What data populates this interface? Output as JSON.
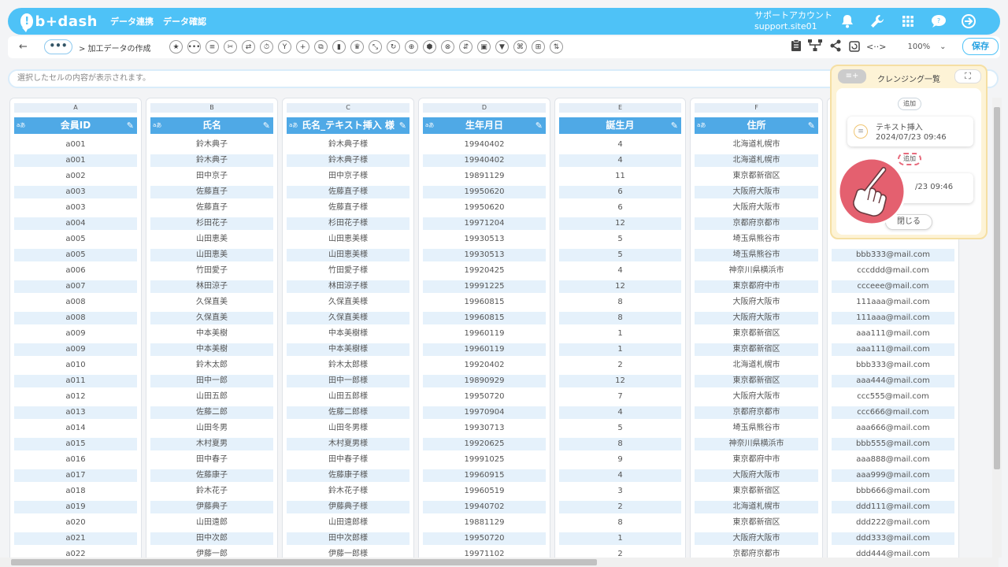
{
  "app": {
    "logo_text": "b+dash",
    "nav": [
      "データ連携",
      "データ確認"
    ],
    "account_name": "サポートアカウント",
    "account_site": "support.site01"
  },
  "toolbar": {
    "back": "←",
    "more": "•••",
    "breadcrumb": "> 加工データの作成",
    "tools": [
      "★",
      "•••",
      "≡",
      "✂",
      "⇄",
      "⏱",
      "Y",
      "+",
      "⧉",
      "▮",
      "♛",
      "⤡",
      "↻",
      "⊕",
      "⬢",
      "⊗",
      "⇵",
      "▣",
      "▼",
      "⌘",
      "⊞",
      "⇅"
    ],
    "right_icons": [
      "clipboard-icon",
      "hierarchy-icon",
      "share-icon",
      "refresh-icon",
      "code-icon"
    ],
    "zoom": "100%",
    "save": "保存"
  },
  "cell_info": "選択したセルの内容が表示されます。",
  "columns": [
    {
      "letter": "A",
      "type": "aあ",
      "name": "会員ID"
    },
    {
      "letter": "B",
      "type": "aあ",
      "name": "氏名"
    },
    {
      "letter": "C",
      "type": "aあ",
      "name": "氏名_テキスト挿入 様"
    },
    {
      "letter": "D",
      "type": "aあ",
      "name": "生年月日"
    },
    {
      "letter": "E",
      "type": "",
      "name": "誕生月"
    },
    {
      "letter": "F",
      "type": "aあ",
      "name": "住所"
    },
    {
      "letter": "",
      "type": "",
      "name": ""
    }
  ],
  "rows": [
    [
      "a001",
      "鈴木典子",
      "鈴木典子様",
      "19940402",
      "4",
      "北海道札幌市",
      ""
    ],
    [
      "a001",
      "鈴木典子",
      "鈴木典子様",
      "19940402",
      "4",
      "北海道札幌市",
      ""
    ],
    [
      "a002",
      "田中京子",
      "田中京子様",
      "19891129",
      "11",
      "東京都新宿区",
      ""
    ],
    [
      "a003",
      "佐藤直子",
      "佐藤直子様",
      "19950620",
      "6",
      "大阪府大阪市",
      ""
    ],
    [
      "a003",
      "佐藤直子",
      "佐藤直子様",
      "19950620",
      "6",
      "大阪府大阪市",
      ""
    ],
    [
      "a004",
      "杉田花子",
      "杉田花子様",
      "19971204",
      "12",
      "京都府京都市",
      ""
    ],
    [
      "a005",
      "山田恵美",
      "山田恵美様",
      "19930513",
      "5",
      "埼玉県熊谷市",
      ""
    ],
    [
      "a005",
      "山田恵美",
      "山田恵美様",
      "19930513",
      "5",
      "埼玉県熊谷市",
      "bbb333@mail.com"
    ],
    [
      "a006",
      "竹田愛子",
      "竹田愛子様",
      "19920425",
      "4",
      "神奈川県横浜市",
      "cccddd@mail.com"
    ],
    [
      "a007",
      "林田涼子",
      "林田涼子様",
      "19991225",
      "12",
      "東京都府中市",
      "ccceee@mail.com"
    ],
    [
      "a008",
      "久保直美",
      "久保直美様",
      "19960815",
      "8",
      "大阪府大阪市",
      "111aaa@mail.com"
    ],
    [
      "a008",
      "久保直美",
      "久保直美様",
      "19960815",
      "8",
      "大阪府大阪市",
      "111aaa@mail.com"
    ],
    [
      "a009",
      "中本美樹",
      "中本美樹様",
      "19960119",
      "1",
      "東京都新宿区",
      "aaa111@mail.com"
    ],
    [
      "a009",
      "中本美樹",
      "中本美樹様",
      "19960119",
      "1",
      "東京都新宿区",
      "aaa111@mail.com"
    ],
    [
      "a010",
      "鈴木太郎",
      "鈴木太郎様",
      "19920402",
      "2",
      "北海道札幌市",
      "bbb333@mail.com"
    ],
    [
      "a011",
      "田中一郎",
      "田中一郎様",
      "19890929",
      "12",
      "東京都新宿区",
      "aaa444@mail.com"
    ],
    [
      "a012",
      "山田五郎",
      "山田五郎様",
      "19950720",
      "7",
      "大阪府大阪市",
      "ccc555@mail.com"
    ],
    [
      "a013",
      "佐藤二郎",
      "佐藤二郎様",
      "19970904",
      "4",
      "京都府京都市",
      "ccc666@mail.com"
    ],
    [
      "a014",
      "山田冬男",
      "山田冬男様",
      "19930713",
      "5",
      "埼玉県熊谷市",
      "aaa666@mail.com"
    ],
    [
      "a015",
      "木村夏男",
      "木村夏男様",
      "19920625",
      "8",
      "神奈川県横浜市",
      "bbb555@mail.com"
    ],
    [
      "a016",
      "田中春子",
      "田中春子様",
      "19991025",
      "9",
      "東京都府中市",
      "aaa888@mail.com"
    ],
    [
      "a017",
      "佐藤康子",
      "佐藤康子様",
      "19960915",
      "4",
      "大阪府大阪市",
      "aaa999@mail.com"
    ],
    [
      "a018",
      "鈴木花子",
      "鈴木花子様",
      "19960519",
      "3",
      "東京都新宿区",
      "bbb666@mail.com"
    ],
    [
      "a019",
      "伊藤典子",
      "伊藤典子様",
      "19940702",
      "2",
      "北海道札幌市",
      "ddd111@mail.com"
    ],
    [
      "a020",
      "山田遠郎",
      "山田遠郎様",
      "19881129",
      "8",
      "東京都新宿区",
      "ddd222@mail.com"
    ],
    [
      "a021",
      "田中次郎",
      "田中次郎様",
      "19950720",
      "1",
      "大阪府大阪市",
      "ddd333@mail.com"
    ],
    [
      "a022",
      "伊藤一郎",
      "伊藤一郎様",
      "19971102",
      "2",
      "京都府京都市",
      "ddd444@mail.com"
    ]
  ],
  "panel": {
    "top_icon": "≡+",
    "title": "クレンジング一覧",
    "expand": "⛶",
    "add_label_1": "追加",
    "step1_name": "テキスト挿入",
    "step1_time": "2024/07/23 09:46",
    "add_label_2": "追加",
    "step2_time": "/23 09:46",
    "close": "閉じる"
  },
  "colors": {
    "header_bg": "#4ec2f7",
    "column_header": "#4fa9e6",
    "cell_alt": "#e5f1fb",
    "panel_bg": "#fdf3d6",
    "pointer_red": "#e4606f"
  }
}
